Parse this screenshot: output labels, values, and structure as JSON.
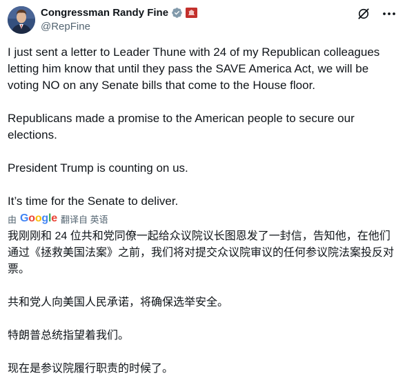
{
  "author": {
    "name": "Congressman Randy Fine",
    "handle": "@RepFine"
  },
  "icons": {
    "verified": "verified-badge-icon",
    "affiliate": "house-seal-icon",
    "grok": "grok-icon",
    "more": "more-options-icon"
  },
  "colors": {
    "verified": "#829aab",
    "affiliate": "#c3302c",
    "text": "#0f1419",
    "secondary": "#536471"
  },
  "tweet": {
    "paragraphs": [
      "I just sent a letter to Leader Thune with 24 of my Republican colleagues letting him know that until they pass the SAVE America Act, we will be voting NO on any Senate bills that come to the House floor.",
      "Republicans made a promise to the American people to secure our elections.",
      "President Trump is counting on us.",
      "It’s time for the Senate to deliver."
    ]
  },
  "translation": {
    "by_label": "由",
    "provider": "Google",
    "action_label": "翻译自 英语",
    "paragraphs": [
      "我刚刚和 24 位共和党同僚一起给众议院议长图恩发了一封信，告知他，在他们通过《拯救美国法案》之前，我们将对提交众议院审议的任何参议院法案投反对票。",
      "共和党人向美国人民承诺，将确保选举安全。",
      "特朗普总统指望着我们。",
      "现在是参议院履行职责的时候了。"
    ]
  }
}
